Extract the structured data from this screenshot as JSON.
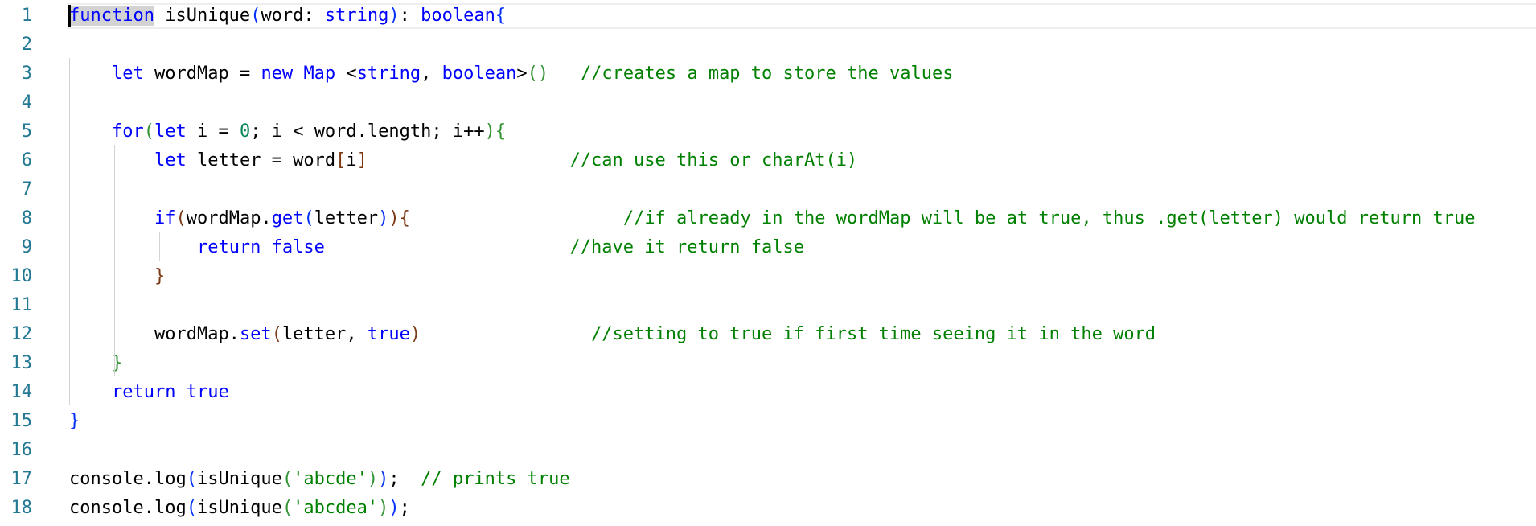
{
  "editor": {
    "lines": [
      {
        "number": "1",
        "tokens": [
          {
            "text": "function",
            "cls": "kw word-hl"
          },
          {
            "text": " isUnique",
            "cls": "blk"
          },
          {
            "text": "(",
            "cls": "p1"
          },
          {
            "text": "word",
            "cls": "blk"
          },
          {
            "text": ": ",
            "cls": "blk"
          },
          {
            "text": "string",
            "cls": "kw"
          },
          {
            "text": ")",
            "cls": "p1"
          },
          {
            "text": ": ",
            "cls": "blk"
          },
          {
            "text": "boolean",
            "cls": "kw"
          },
          {
            "text": "{",
            "cls": "p1"
          }
        ]
      },
      {
        "number": "2",
        "tokens": []
      },
      {
        "number": "3",
        "tokens": [
          {
            "text": "    ",
            "cls": "blk"
          },
          {
            "text": "let",
            "cls": "kw"
          },
          {
            "text": " wordMap = ",
            "cls": "blk"
          },
          {
            "text": "new",
            "cls": "kw"
          },
          {
            "text": " ",
            "cls": "blk"
          },
          {
            "text": "Map",
            "cls": "kw"
          },
          {
            "text": " <",
            "cls": "blk"
          },
          {
            "text": "string",
            "cls": "kw"
          },
          {
            "text": ", ",
            "cls": "blk"
          },
          {
            "text": "boolean",
            "cls": "kw"
          },
          {
            "text": ">",
            "cls": "blk"
          },
          {
            "text": "()",
            "cls": "p2"
          },
          {
            "text": "   //creates a map to store the values",
            "cls": "cm"
          }
        ]
      },
      {
        "number": "4",
        "tokens": []
      },
      {
        "number": "5",
        "tokens": [
          {
            "text": "    ",
            "cls": "blk"
          },
          {
            "text": "for",
            "cls": "kw"
          },
          {
            "text": "(",
            "cls": "p2"
          },
          {
            "text": "let",
            "cls": "kw"
          },
          {
            "text": " i = ",
            "cls": "blk"
          },
          {
            "text": "0",
            "cls": "num"
          },
          {
            "text": "; i < word.length; i++",
            "cls": "blk"
          },
          {
            "text": ")",
            "cls": "p2"
          },
          {
            "text": "{",
            "cls": "p2"
          }
        ]
      },
      {
        "number": "6",
        "tokens": [
          {
            "text": "        ",
            "cls": "blk"
          },
          {
            "text": "let",
            "cls": "kw"
          },
          {
            "text": " letter = word",
            "cls": "blk"
          },
          {
            "text": "[",
            "cls": "p3"
          },
          {
            "text": "i",
            "cls": "blk"
          },
          {
            "text": "]",
            "cls": "p3"
          },
          {
            "text": "                   //can use this or charAt(i)",
            "cls": "cm"
          }
        ]
      },
      {
        "number": "7",
        "tokens": []
      },
      {
        "number": "8",
        "tokens": [
          {
            "text": "        ",
            "cls": "blk"
          },
          {
            "text": "if",
            "cls": "kw"
          },
          {
            "text": "(",
            "cls": "p3"
          },
          {
            "text": "wordMap.",
            "cls": "blk"
          },
          {
            "text": "get",
            "cls": "kw"
          },
          {
            "text": "(",
            "cls": "p1"
          },
          {
            "text": "letter",
            "cls": "blk"
          },
          {
            "text": ")",
            "cls": "p1"
          },
          {
            "text": ")",
            "cls": "p3"
          },
          {
            "text": "{",
            "cls": "p3"
          },
          {
            "text": "                    //if already in the wordMap will be at true, thus .get(letter) would return true",
            "cls": "cm"
          }
        ]
      },
      {
        "number": "9",
        "tokens": [
          {
            "text": "            ",
            "cls": "blk"
          },
          {
            "text": "return",
            "cls": "kw"
          },
          {
            "text": " ",
            "cls": "blk"
          },
          {
            "text": "false",
            "cls": "kw"
          },
          {
            "text": "                       //have it return false",
            "cls": "cm"
          }
        ]
      },
      {
        "number": "10",
        "tokens": [
          {
            "text": "        ",
            "cls": "blk"
          },
          {
            "text": "}",
            "cls": "p3"
          }
        ]
      },
      {
        "number": "11",
        "tokens": []
      },
      {
        "number": "12",
        "tokens": [
          {
            "text": "        ",
            "cls": "blk"
          },
          {
            "text": "wordMap.",
            "cls": "blk"
          },
          {
            "text": "set",
            "cls": "kw"
          },
          {
            "text": "(",
            "cls": "p3"
          },
          {
            "text": "letter, ",
            "cls": "blk"
          },
          {
            "text": "true",
            "cls": "kw"
          },
          {
            "text": ")",
            "cls": "p3"
          },
          {
            "text": "                //setting to true if first time seeing it in the word",
            "cls": "cm"
          }
        ]
      },
      {
        "number": "13",
        "tokens": [
          {
            "text": "    ",
            "cls": "blk"
          },
          {
            "text": "}",
            "cls": "p2"
          }
        ]
      },
      {
        "number": "14",
        "tokens": [
          {
            "text": "    ",
            "cls": "blk"
          },
          {
            "text": "return",
            "cls": "kw"
          },
          {
            "text": " ",
            "cls": "blk"
          },
          {
            "text": "true",
            "cls": "kw"
          }
        ]
      },
      {
        "number": "15",
        "tokens": [
          {
            "text": "}",
            "cls": "p1"
          }
        ]
      },
      {
        "number": "16",
        "tokens": []
      },
      {
        "number": "17",
        "tokens": [
          {
            "text": "console.log",
            "cls": "blk"
          },
          {
            "text": "(",
            "cls": "p1"
          },
          {
            "text": "isUnique",
            "cls": "blk"
          },
          {
            "text": "(",
            "cls": "p2"
          },
          {
            "text": "'abcde'",
            "cls": "cm"
          },
          {
            "text": ")",
            "cls": "p2"
          },
          {
            "text": ")",
            "cls": "p1"
          },
          {
            "text": ";  ",
            "cls": "blk"
          },
          {
            "text": "// prints true",
            "cls": "cm"
          }
        ]
      },
      {
        "number": "18",
        "tokens": [
          {
            "text": "console.log",
            "cls": "blk"
          },
          {
            "text": "(",
            "cls": "p1"
          },
          {
            "text": "isUnique",
            "cls": "blk"
          },
          {
            "text": "(",
            "cls": "p2"
          },
          {
            "text": "'abcdea'",
            "cls": "cm"
          },
          {
            "text": ")",
            "cls": "p2"
          },
          {
            "text": ")",
            "cls": "p1"
          },
          {
            "text": ";",
            "cls": "blk"
          }
        ]
      }
    ]
  }
}
